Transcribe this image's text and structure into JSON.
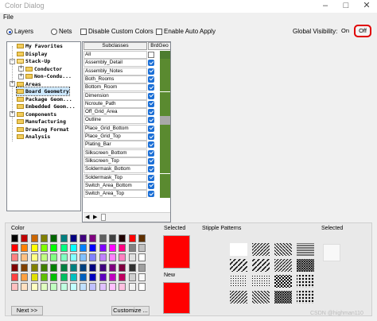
{
  "window": {
    "title": "Color Dialog",
    "minimize_icon": "minimize-icon",
    "maximize_icon": "maximize-icon",
    "close_icon": "close-icon"
  },
  "menu": {
    "file": "File"
  },
  "options": {
    "layers": "Layers",
    "nets": "Nets",
    "disable_custom_colors": "Disable Custom Colors",
    "enable_auto_apply": "Enable Auto Apply",
    "global_visibility": "Global Visibility:",
    "on": "On",
    "off": "Off"
  },
  "tree": {
    "items": [
      {
        "label": "My Favorites"
      },
      {
        "label": "Display"
      },
      {
        "label": "Stack-Up"
      },
      {
        "label": "Conductor"
      },
      {
        "label": "Non-Condu..."
      },
      {
        "label": "Areas"
      },
      {
        "label": "Board Geometry"
      },
      {
        "label": "Package Geom..."
      },
      {
        "label": "Embedded Geom..."
      },
      {
        "label": "Components"
      },
      {
        "label": "Manufacturing"
      },
      {
        "label": "Drawing Format"
      },
      {
        "label": "Analysis"
      }
    ]
  },
  "grid": {
    "headers": {
      "subclasses": "Subclasses",
      "brdgeo": "BrdGeo"
    },
    "rows": [
      {
        "name": "All",
        "color": "#4c7c2e"
      },
      {
        "name": "Assembly_Detail",
        "color": "#5a8a30"
      },
      {
        "name": "Assembly_Notes",
        "color": "#5a8a30"
      },
      {
        "name": "Both_Rooms",
        "color": "#5a8a30"
      },
      {
        "name": "Bottom_Room",
        "color": "#5a8a30"
      },
      {
        "name": "Dimension",
        "color": "#5a8a30"
      },
      {
        "name": "Ncroute_Path",
        "color": "#5a8a30"
      },
      {
        "name": "Off_Grid_Area",
        "color": "#5a8a30"
      },
      {
        "name": "Outline",
        "color": "#a8a8a8"
      },
      {
        "name": "Place_Grid_Bottom",
        "color": "#5a8a30"
      },
      {
        "name": "Place_Grid_Top",
        "color": "#5a8a30"
      },
      {
        "name": "Plating_Bar",
        "color": "#5a8a30"
      },
      {
        "name": "Silkscreen_Bottom",
        "color": "#5a8a30"
      },
      {
        "name": "Silkscreen_Top",
        "color": "#5a8a30"
      },
      {
        "name": "Soldermask_Bottom",
        "color": "#5a8a30"
      },
      {
        "name": "Soldermask_Top",
        "color": "#5a8a30"
      },
      {
        "name": "Switch_Area_Bottom",
        "color": "#5a8a30"
      },
      {
        "name": "Switch_Area_Top",
        "color": "#5a8a30"
      }
    ]
  },
  "color_section": {
    "label": "Color",
    "next_button": "Next >>",
    "customize_button": "Customize ...",
    "palette": [
      [
        "#000000",
        "#c00000",
        "#cc6600",
        "#808000",
        "#006600",
        "#008080",
        "#000080",
        "#400080",
        "#800080",
        "#606060",
        "#404040",
        "#200000",
        "#ff0000",
        "#603000"
      ],
      [
        "#ff0000",
        "#ff8000",
        "#ffff00",
        "#80ff00",
        "#00ff00",
        "#00ff80",
        "#00ffff",
        "#0080ff",
        "#0000ff",
        "#8000ff",
        "#ff00ff",
        "#ff0080",
        "#808080",
        "#c0c0c0"
      ],
      [
        "#ff8080",
        "#ffc080",
        "#ffff80",
        "#c0ff80",
        "#80ff80",
        "#80ffc0",
        "#80ffff",
        "#80c0ff",
        "#8080ff",
        "#c080ff",
        "#ff80ff",
        "#ff80c0",
        "#e0e0e0",
        "#ffffff"
      ],
      [
        "#800000",
        "#804000",
        "#808000",
        "#408000",
        "#008000",
        "#008040",
        "#008080",
        "#004080",
        "#000080",
        "#400080",
        "#800080",
        "#800040",
        "#303030",
        "#a0a0a0"
      ],
      [
        "#ff4040",
        "#ffa040",
        "#e0e000",
        "#60c000",
        "#00c000",
        "#00c060",
        "#00c0c0",
        "#0060c0",
        "#0000c0",
        "#6000c0",
        "#c000c0",
        "#c00060",
        "#d0d0d0",
        "#f8f8f8"
      ],
      [
        "#ffc0c0",
        "#ffe0c0",
        "#ffffc0",
        "#e0ffc0",
        "#c0ffc0",
        "#c0ffe0",
        "#c0ffff",
        "#c0e0ff",
        "#c0c0ff",
        "#e0c0ff",
        "#ffc0ff",
        "#ffc0e0",
        "#f0f0f0",
        "#ffffff"
      ]
    ]
  },
  "selected_section": {
    "label": "Selected",
    "new_label": "New",
    "selected_color": "#ff0000",
    "new_color": "#ff0000"
  },
  "stipple_section": {
    "label": "Stipple Patterns",
    "selected_label": "Selected"
  },
  "watermark": "CSDN @highman110"
}
